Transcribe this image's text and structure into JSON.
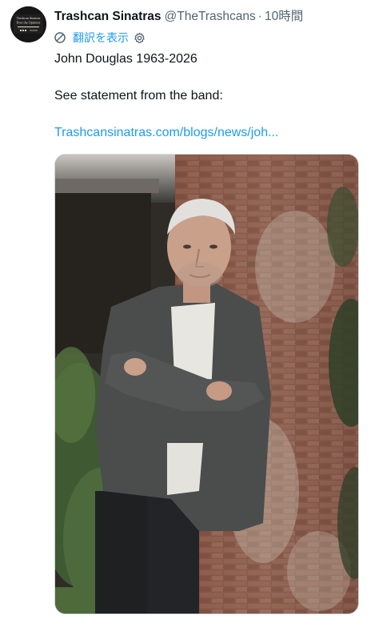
{
  "tweet": {
    "author": {
      "display_name": "Trashcan Sinatras",
      "handle": "@TheTrashcans",
      "avatar_text_line1": "Trashcan Sinatras",
      "avatar_text_line2": "Ever the Optimist"
    },
    "separator": "·",
    "time_ago": "10時間",
    "translate": {
      "label": "翻訳を表示",
      "icon": "translate-icon",
      "settings_icon": "gear-icon"
    },
    "text_lines": [
      "John Douglas 1963-2026",
      "See statement from the band:"
    ],
    "link_text": "Trashcansinatras.com/blogs/news/joh...",
    "media": {
      "kind": "photo"
    }
  },
  "colors": {
    "text_primary": "#0f1419",
    "text_secondary": "#536471",
    "link": "#1d9bf0",
    "border": "#cfd9de"
  }
}
